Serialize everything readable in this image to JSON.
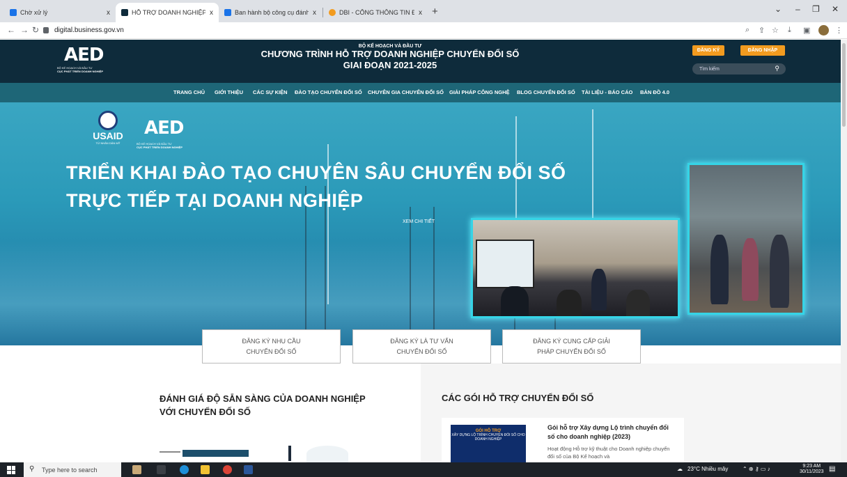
{
  "browser": {
    "tabs": [
      {
        "title": "Chờ xử lý",
        "favicon_color": "#1a73e8"
      },
      {
        "title": "HỖ TRỢ DOANH NGHIỆP CHUY",
        "favicon_color": "#0e2b3b"
      },
      {
        "title": "Ban hành bộ công cụ đánh giá",
        "favicon_color": "#1a73e8"
      },
      {
        "title": "DBI - CỔNG THÔNG TIN ĐÁNH",
        "favicon_color": "#f29b1f"
      }
    ],
    "close_glyph": "x",
    "new_tab_glyph": "+",
    "url": "digital.business.gov.vn"
  },
  "site": {
    "logo_text": "AED",
    "logo_sub_line1": "BỘ KẾ HOẠCH VÀ ĐẦU TƯ",
    "logo_sub_line2": "CỤC PHÁT TRIỂN DOANH NGHIỆP",
    "ministry": "BỘ KẾ HOẠCH VÀ ĐẦU TƯ",
    "program_line1": "CHƯƠNG TRÌNH HỖ TRỢ DOANH NGHIỆP CHUYỂN ĐỔI SỐ",
    "program_line2": "GIAI ĐOẠN 2021-2025",
    "register_label": "ĐĂNG KÝ",
    "login_label": "ĐĂNG NHẬP",
    "search_placeholder": "Tìm kiếm"
  },
  "nav": [
    "TRANG CHỦ",
    "GIỚI THIỆU",
    "CÁC SỰ KIỆN",
    "ĐÀO TẠO CHUYỂN ĐỔI SỐ",
    "CHUYÊN GIA CHUYỂN ĐỔI SỐ",
    "GIẢI PHÁP CÔNG NGHỆ",
    "BLOG CHUYỂN ĐỔI SỐ",
    "TÀI LIỆU - BÁO CÁO",
    "BẢN ĐỒ 4.0"
  ],
  "hero": {
    "usaid": "USAID",
    "usaid_sub": "TỪ NHÂN DÂN MỸ",
    "title_line1": "TRIỂN KHAI ĐÀO TẠO CHUYÊN SÂU CHUYỂN ĐỔI SỐ",
    "title_line2": "TRỰC TIẾP TẠI DOANH NGHIỆP",
    "more": "XEM CHI TIẾT"
  },
  "cta": [
    {
      "line1": "ĐĂNG KÝ NHU CẦU",
      "line2": "CHUYỂN ĐỔI SỐ"
    },
    {
      "line1": "ĐĂNG KÝ LÀ TƯ VẤN",
      "line2": "CHUYỂN ĐỔI SỐ"
    },
    {
      "line1": "ĐĂNG KÝ CUNG CẤP GIẢI",
      "line2": "PHÁP CHUYỂN ĐỔI SỐ"
    }
  ],
  "assessment": {
    "title_line1": "ĐÁNH GIÁ ĐỘ SẴN SÀNG CỦA DOANH NGHIỆP",
    "title_line2": "VỚI CHUYỂN ĐỔI SỐ"
  },
  "packages": {
    "title": "CÁC GÓI HỖ TRỢ CHUYỂN ĐỔI SỐ",
    "card_img_title": "GÓI HỖ TRỢ",
    "card_img_sub": "XÂY DỰNG LỘ TRÌNH CHUYỂN ĐỔI SỐ CHO DOANH NGHIỆP",
    "card_title": "Gói hỗ trợ Xây dựng Lộ trình chuyển đổi số cho doanh nghiệp (2023)",
    "card_desc": "Hoạt động Hỗ trợ kỹ thuật cho Doanh nghiệp chuyển đổi số của Bộ Kế hoạch và"
  },
  "taskbar": {
    "search": "Type here to search",
    "weather": "23°C  Nhiều mây",
    "time": "9:23 AM",
    "date": "30/11/2023"
  }
}
